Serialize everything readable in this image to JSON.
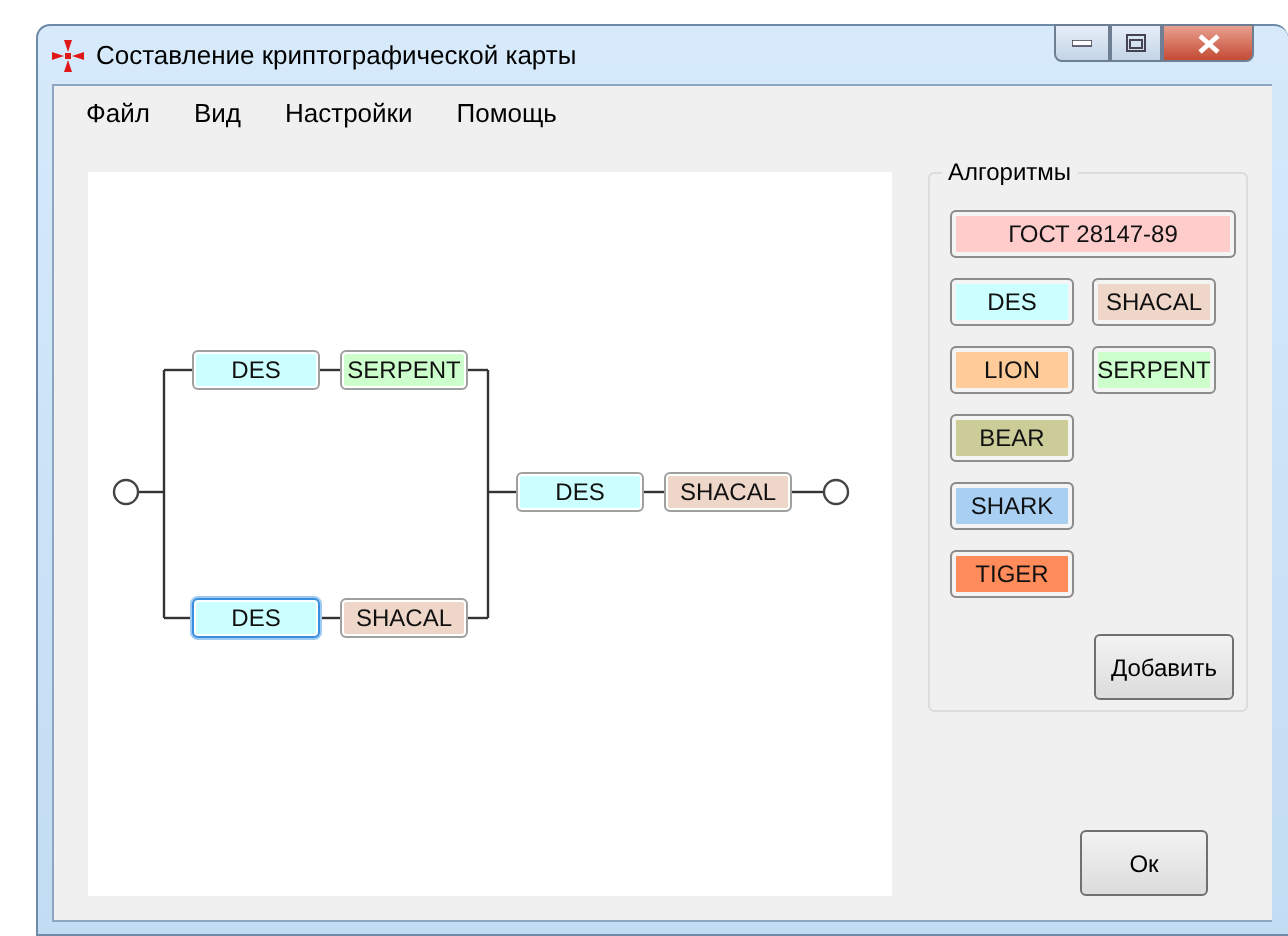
{
  "window": {
    "title": "Составление криптографической карты"
  },
  "menu": [
    "Файл",
    "Вид",
    "Настройки",
    "Помощь"
  ],
  "diagram": {
    "parallel": [
      [
        {
          "label": "DES",
          "color": "#ccffff",
          "selected": false
        },
        {
          "label": "SERPENT",
          "color": "#ccffcc",
          "selected": false
        }
      ],
      [
        {
          "label": "DES",
          "color": "#ccffff",
          "selected": true
        },
        {
          "label": "SHACAL",
          "color": "#eed6c8",
          "selected": false
        }
      ]
    ],
    "sequence": [
      {
        "label": "DES",
        "color": "#ccffff",
        "selected": false
      },
      {
        "label": "SHACAL",
        "color": "#eed6c8",
        "selected": false
      }
    ]
  },
  "algorithms": {
    "title": "Алгоритмы",
    "rows": [
      [
        {
          "label": "ГОСТ 28147-89",
          "color": "#ffcccc",
          "kind": "wide"
        }
      ],
      [
        {
          "label": "DES",
          "color": "#ccffff",
          "kind": "normal"
        },
        {
          "label": "SHACAL",
          "color": "#eed6c8",
          "kind": "normal"
        }
      ],
      [
        {
          "label": "LION",
          "color": "#ffcc99",
          "kind": "normal"
        },
        {
          "label": "SERPENT",
          "color": "#ccffcc",
          "kind": "normal"
        }
      ],
      [
        {
          "label": "BEAR",
          "color": "#cccc99",
          "kind": "normal"
        }
      ],
      [
        {
          "label": "SHARK",
          "color": "#a9cff2",
          "kind": "normal"
        }
      ],
      [
        {
          "label": "TIGER",
          "color": "#ff8c5a",
          "kind": "normal"
        }
      ]
    ],
    "add_button": "Добавить"
  },
  "ok_button": "Ок"
}
